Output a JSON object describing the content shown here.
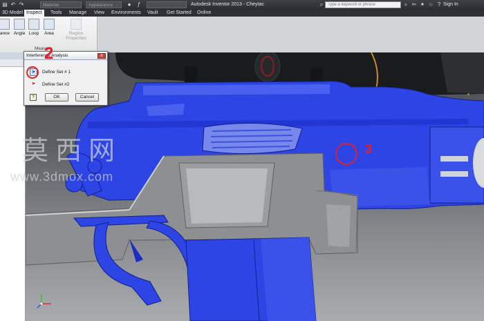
{
  "titlebar": {
    "material": "Material",
    "appearance": "Appearance",
    "app_title": "Autodesk Inventor 2013 - Cheytac",
    "search_placeholder": "Type a keyword or phrase",
    "sign_in": "Sign In"
  },
  "tabs": [
    "3D Model",
    "Inspect",
    "Tools",
    "Manage",
    "View",
    "Environments",
    "Vault",
    "Get Started",
    "Online"
  ],
  "active_tab": "Inspect",
  "ribbon": {
    "buttons": [
      "tance",
      "Angle",
      "Loop",
      "Area",
      "Region Properties"
    ],
    "panel_label": "Measure"
  },
  "dialog": {
    "title": "Interference Analysis",
    "set1_label": "Define Set # 1",
    "set2_label": "Define Set #2",
    "help": "?",
    "ok": "OK",
    "cancel": "Cancel",
    "close": "x"
  },
  "annotations": {
    "step2": "2",
    "step3": "3"
  },
  "watermark": {
    "chinese": "莫西网",
    "url": "www.3dmox.com"
  },
  "colors": {
    "selection_blue": "#1f3de0",
    "annotation_red": "#e0202a",
    "body_gray": "#8e8f92"
  }
}
